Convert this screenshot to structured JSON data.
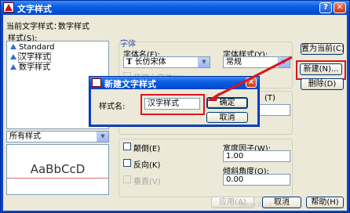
{
  "window": {
    "title": "文字样式",
    "help_label": "?",
    "close_label": "✕"
  },
  "current_style": {
    "label": "当前文字样式：",
    "value": "数字样式"
  },
  "styles": {
    "label": "样式(S):",
    "items": [
      {
        "name": "Standard",
        "selected": false
      },
      {
        "name": "汉字样式",
        "selected": true
      },
      {
        "name": "数字样式",
        "selected": false
      }
    ],
    "filter_value": "所有样式"
  },
  "preview": {
    "text": "AaBbCcD"
  },
  "font": {
    "group_label": "字体",
    "name_label": "字体名(F):",
    "name_value": "长仿宋体",
    "style_label": "字体样式(Y):",
    "style_value": "常规",
    "big_font_label": "使用大字体(U)"
  },
  "effects": {
    "upside_down": "颠倒(E)",
    "backwards": "反向(K)",
    "vertical": "垂直(V)",
    "width_factor_label": "宽度因子(W):",
    "width_factor_value": "1.00",
    "oblique_label": "倾斜角度(O):",
    "oblique_value": "0.00"
  },
  "buttons": {
    "set_current": "置为当前(C)",
    "new": "新建(N)...",
    "delete": "删除(D)",
    "apply": "应用(A)",
    "cancel": "取消",
    "help": "帮助(H)"
  },
  "new_style_dialog": {
    "title": "新建文字样式",
    "name_label": "样式名:",
    "name_value": "汉字样式",
    "ok": "确定",
    "cancel": "取消",
    "close_label": "✕"
  },
  "watermark": "www.it...c.com",
  "colors": {
    "highlight": "#d7161e",
    "title_bar": "#0a5fe4"
  }
}
